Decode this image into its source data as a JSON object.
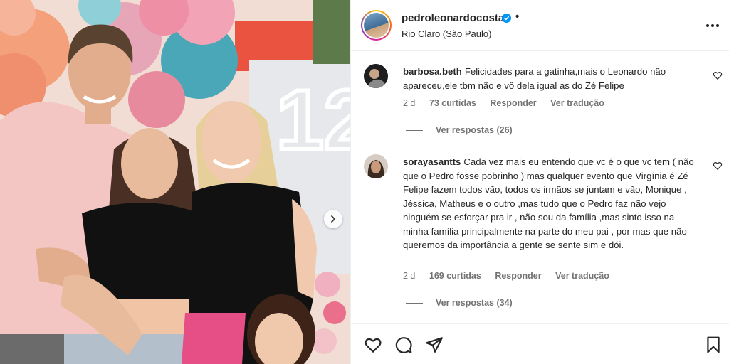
{
  "post": {
    "username": "pedroleonardocosta",
    "separator": "•",
    "location": "Rio Claro (São Paulo)",
    "verified": true,
    "icons": {
      "avatar": "profile-avatar",
      "verified": "verified-badge-icon",
      "more": "more-options-icon",
      "carousel": "chevron-right-icon"
    }
  },
  "photo": {
    "description_hidden": true,
    "balloon_colors": [
      "#f4a07a",
      "#e86f8c",
      "#5bb5c5",
      "#ee8fa6",
      "#f0b0c0"
    ],
    "neon_number": "12"
  },
  "comments": [
    {
      "username": "barbosa.beth",
      "text": "Felicidades para a gatinha,mais o Leonardo não apareceu,ele tbm não e vô dela igual as do Zé Felipe",
      "age": "2 d",
      "likes": "73 curtidas",
      "reply_label": "Responder",
      "translate_label": "Ver tradução",
      "view_replies": "Ver respostas (26)"
    },
    {
      "username": "sorayasantts",
      "text": "Cada vez mais eu entendo que vc é o que vc tem ( não que o Pedro fosse pobrinho ) mas qualquer evento que Virgínia é Zé Felipe fazem todos vão, todos os irmãos se juntam e vão, Monique , Jéssica, Matheus e o outro ,mas tudo que o Pedro faz não vejo ninguém se esforçar pra ir , não sou da família ,mas sinto isso na minha família principalmente na parte do meu pai , por mas que não queremos da importância a gente se sente sim e dói.",
      "age": "2 d",
      "likes": "169 curtidas",
      "reply_label": "Responder",
      "translate_label": "Ver tradução",
      "view_replies": "Ver respostas (34)"
    }
  ],
  "actions": {
    "icons": [
      "heart-icon",
      "comment-icon",
      "share-icon",
      "bookmark-icon"
    ]
  },
  "colors": {
    "text": "#262626",
    "muted": "#737373",
    "verified": "#0095f6",
    "divider": "#efefef"
  }
}
